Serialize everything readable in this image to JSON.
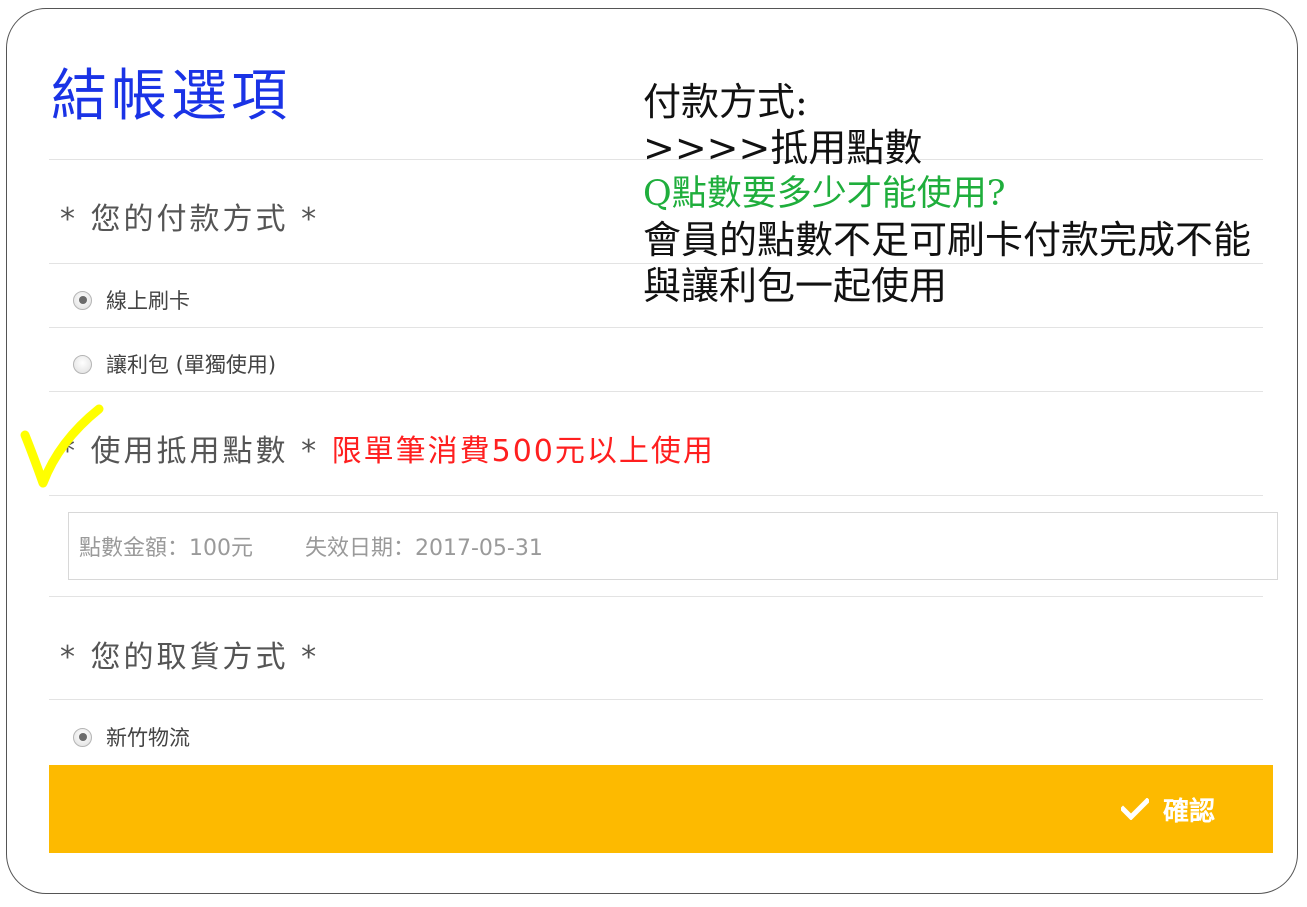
{
  "checkout": {
    "title": "結帳選項",
    "payment_section": {
      "title": "* 您的付款方式 *",
      "options": [
        {
          "label": "線上刷卡",
          "selected": true
        },
        {
          "label": "讓利包 (單獨使用)",
          "selected": false
        }
      ]
    },
    "points_section": {
      "title": "* 使用抵用點數 *",
      "note": "限單筆消費500元以上使用",
      "amount": "點數金額：100元",
      "expiry": "失效日期：2017-05-31"
    },
    "delivery_section": {
      "title": "* 您的取貨方式 *",
      "options": [
        {
          "label": "新竹物流",
          "selected": true
        }
      ]
    },
    "confirm_label": "確認"
  },
  "annotation": {
    "line1": "付款方式:",
    "line2": ">>>>抵用點數",
    "question": "Q點數要多少才能使用?",
    "answer": "會員的點數不足可刷卡付款完成不能與讓利包一起使用"
  },
  "colors": {
    "title": "#1a33e6",
    "note": "#ff1f1f",
    "confirm_bg": "#fdba00",
    "question": "#1fae3c",
    "check_mark": "#ffff00"
  },
  "icons": {
    "confirm": "checkmark-icon",
    "annotation_mark": "handwritten-check-mark"
  }
}
